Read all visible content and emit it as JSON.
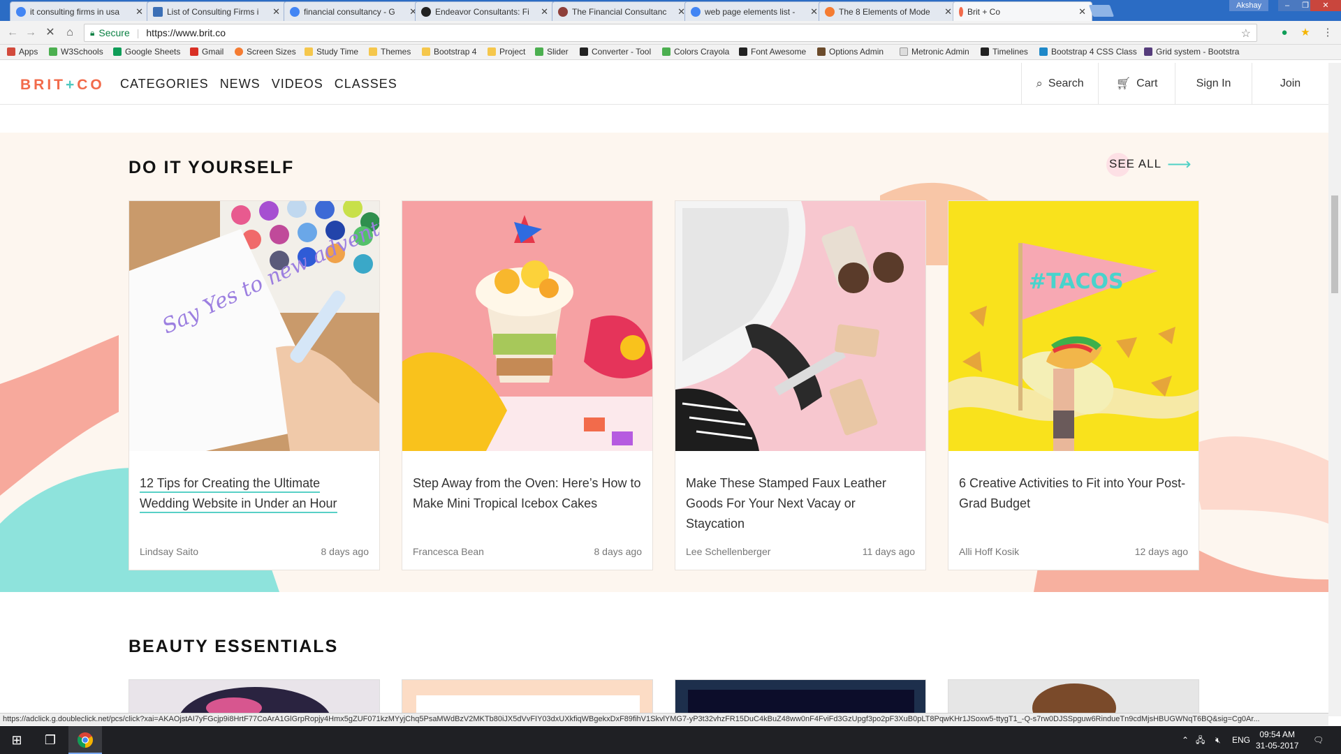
{
  "browser": {
    "tabs": [
      {
        "title": "it consulting firms in usa",
        "favicon_color": "#4285f4"
      },
      {
        "title": "List of Consulting Firms i",
        "favicon_color": "#3b6fb6"
      },
      {
        "title": "financial consultancy - G",
        "favicon_color": "#4285f4"
      },
      {
        "title": "Endeavor Consultants: Fi",
        "favicon_color": "#222222"
      },
      {
        "title": "The Financial Consultanc",
        "favicon_color": "#8e3f3a"
      },
      {
        "title": "web page elements list -",
        "favicon_color": "#4285f4"
      },
      {
        "title": "The 8 Elements of Mode",
        "favicon_color": "#f57c32"
      },
      {
        "title": "Brit + Co",
        "favicon_color": "#f26b4b"
      }
    ],
    "profile_name": "Akshay",
    "secure_label": "Secure",
    "url": "https://www.brit.co",
    "bookmarks": [
      {
        "label": "Apps",
        "color": "#d24a3c"
      },
      {
        "label": "W3Schools",
        "color": "#4caf50"
      },
      {
        "label": "Google Sheets",
        "color": "#0f9d58"
      },
      {
        "label": "Gmail",
        "color": "#d93025"
      },
      {
        "label": "Screen Sizes",
        "color": "#f57c32"
      },
      {
        "label": "Study Time",
        "color": "#f5c74c"
      },
      {
        "label": "Themes",
        "color": "#f5c74c"
      },
      {
        "label": "Bootstrap 4",
        "color": "#f5c74c"
      },
      {
        "label": "Project",
        "color": "#f5c74c"
      },
      {
        "label": "Slider",
        "color": "#4caf50"
      },
      {
        "label": "Converter - Tool",
        "color": "#222222"
      },
      {
        "label": "Colors Crayola",
        "color": "#4caf50"
      },
      {
        "label": "Font Awesome",
        "color": "#222222"
      },
      {
        "label": "Options Admin",
        "color": "#6b4b2b"
      },
      {
        "label": "Metronic Admin",
        "color": "#999999"
      },
      {
        "label": "Timelines",
        "color": "#222222"
      },
      {
        "label": "Bootstrap 4 CSS Class",
        "color": "#1e88c8"
      },
      {
        "label": "Grid system - Bootstra",
        "color": "#563d7c"
      }
    ],
    "status_url": "https://adclick.g.doubleclick.net/pcs/click?xai=AKAOjstAI7yFGcjp9i8HrtF77CoArA1GlGrpRopjy4Hmx5gZUF071kzMYyjChq5PsaMWdBzV2MKTb80iJX5dVvFIY03dxUXkfiqWBgekxDxF89fihV1SkvlYMG7-yP3t32vhzFR15DuC4kBuZ48ww0nF4FviFd3GzUpgf3po2pF3XuB0pLT8PqwKHr1JSoxw5-ttygT1_-Q-s7rw0DJSSpguw6RindueTn9cdMjsHBUGWNqT6BQ&sig=Cg0Ar..."
  },
  "site": {
    "logo_left": "BRIT",
    "logo_plus": "+",
    "logo_right": "CO",
    "nav": [
      "CATEGORIES",
      "NEWS",
      "VIDEOS",
      "CLASSES"
    ],
    "actions": {
      "search": "Search",
      "cart": "Cart",
      "signin": "Sign In",
      "join": "Join"
    }
  },
  "diy": {
    "title": "DO IT YOURSELF",
    "see_all": "SEE ALL",
    "cards": [
      {
        "title": "12 Tips for Creating the Ultimate Wedding Website in Under an Hour",
        "author": "Lindsay Saito",
        "time": "8 days ago",
        "image_text": "Say Yes to new adventures"
      },
      {
        "title": "Step Away from the Oven: Here’s How to Make Mini Tropical Icebox Cakes",
        "author": "Francesca Bean",
        "time": "8 days ago"
      },
      {
        "title": "Make These Stamped Faux Leather Goods For Your Next Vacay or Staycation",
        "author": "Lee Schellenberger",
        "time": "11 days ago"
      },
      {
        "title": "6 Creative Activities to Fit into Your Post-Grad Budget",
        "author": "Alli Hoff Kosik",
        "time": "12 days ago",
        "image_text": "#TACOS"
      }
    ]
  },
  "beauty": {
    "title": "BEAUTY ESSENTIALS"
  },
  "taskbar": {
    "lang": "ENG",
    "time": "09:54 AM",
    "date": "31-05-2017"
  },
  "colors": {
    "brand_coral": "#f26b4b",
    "brand_teal": "#4fc9c0",
    "section_bg": "#fdf6ef",
    "underline": "#58d0c6"
  }
}
